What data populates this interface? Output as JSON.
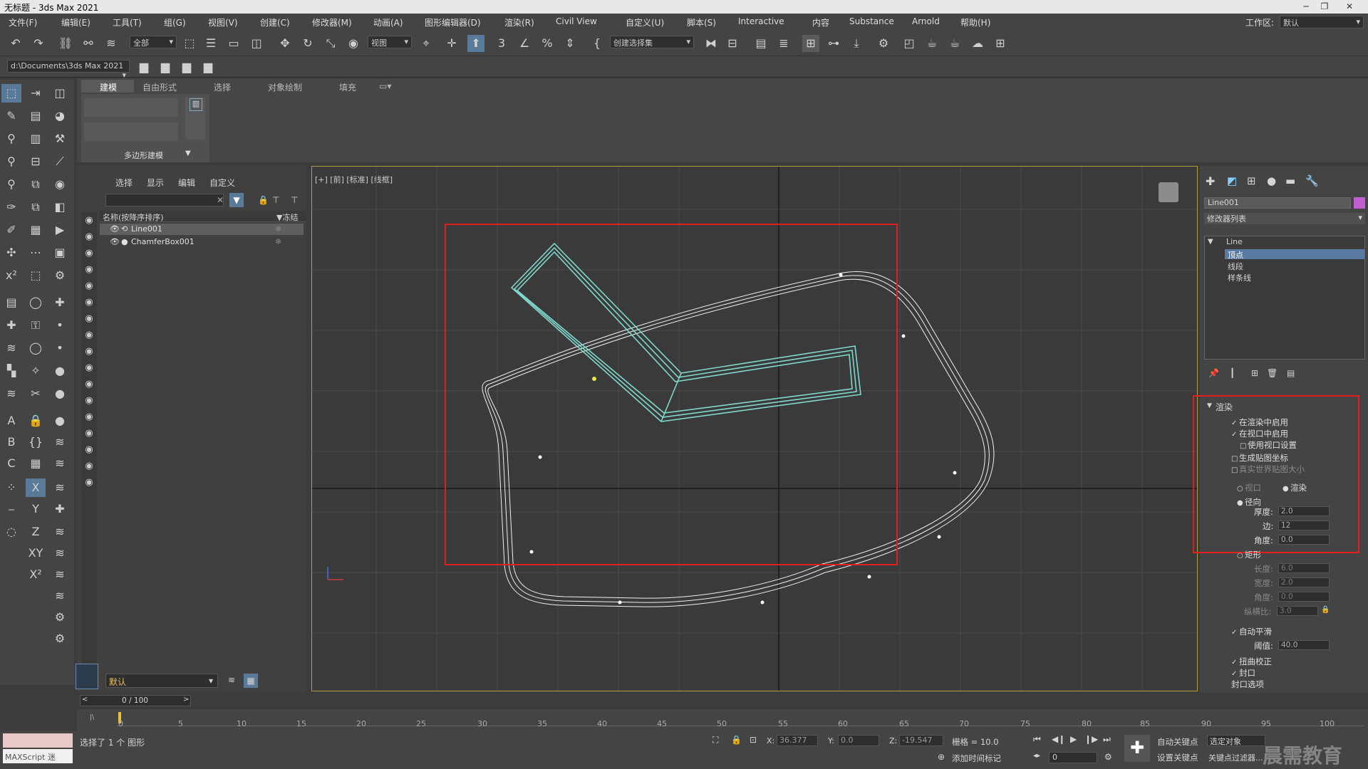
{
  "window": {
    "title": "无标题 - 3ds Max 2021",
    "minimize": "─",
    "restore": "❐",
    "close": "✕"
  },
  "menu": [
    "文件(F)",
    "编辑(E)",
    "工具(T)",
    "组(G)",
    "视图(V)",
    "创建(C)",
    "修改器(M)",
    "动画(A)",
    "图形编辑器(D)",
    "渲染(R)",
    "Civil View",
    "自定义(U)",
    "脚本(S)",
    "Interactive",
    "内容",
    "Substance",
    "Arnold",
    "帮助(H)"
  ],
  "workspace": {
    "label": "工作区:",
    "value": "默认"
  },
  "toolbar": {
    "filter": "全部",
    "coord": "视图",
    "selection_set": "创建选择集",
    "project_path": "d:\\Documents\\3ds Max 2021"
  },
  "ribbon": {
    "tabs": [
      "建模",
      "自由形式",
      "选择",
      "对象绘制",
      "填充"
    ],
    "group_label": "多边形建模"
  },
  "explorer": {
    "tabs": [
      "选择",
      "显示",
      "编辑",
      "自定义"
    ],
    "col_name": "名称(按降序排序)",
    "col_freeze": "▼冻结",
    "rows": [
      "Line001",
      "ChamferBox001"
    ],
    "layer": "默认"
  },
  "viewport": {
    "label": "[+] [前] [标准] [线框]"
  },
  "cmdpanel": {
    "object_name": "Line001",
    "modifier_list": "修改器列表",
    "stack": {
      "root": "Line",
      "items": [
        "顶点",
        "线段",
        "样条线"
      ]
    },
    "rollout_title": "渲染",
    "opts": {
      "enable_render": "在渲染中启用",
      "enable_viewport": "在视口中启用",
      "use_vp_settings": "使用视口设置",
      "gen_map": "生成贴图坐标",
      "real_world": "真实世界贴图大小",
      "viewport": "视口",
      "render": "渲染",
      "radial": "径向",
      "thickness_label": "厚度:",
      "thickness": "2.0",
      "sides_label": "边:",
      "sides": "12",
      "angle_label": "角度:",
      "angle": "0.0",
      "rect": "矩形",
      "length_label": "长度:",
      "length": "6.0",
      "width_label": "宽度:",
      "width": "2.0",
      "rangle_label": "角度:",
      "rangle": "0.0",
      "aspect_label": "纵横比:",
      "aspect": "3.0",
      "auto_smooth": "自动平滑",
      "threshold_label": "阈值:",
      "threshold": "40.0",
      "twist": "扭曲校正",
      "cap": "封口",
      "cap_opts": "封口选项"
    }
  },
  "timeline": {
    "frame": "0 / 100",
    "ticks": [
      "0",
      "5",
      "10",
      "15",
      "20",
      "25",
      "30",
      "35",
      "40",
      "45",
      "50",
      "55",
      "60",
      "65",
      "70",
      "75",
      "80",
      "85",
      "90",
      "95",
      "100"
    ]
  },
  "status": {
    "selection": "选择了 1 个 图形",
    "x_label": "X:",
    "x": "36.377",
    "y_label": "Y:",
    "y": "0.0",
    "z_label": "Z:",
    "z": "-19.547",
    "grid": "栅格 = 10.0",
    "add_time_tag": "添加时间标记",
    "auto_key": "自动关键点",
    "set_key": "设置关键点",
    "selected_obj": "选定对象",
    "key_filter": "关键点过滤器...",
    "frame_field": "0",
    "maxscript": "MAXScript 迷",
    "watermark": "晨需教育"
  }
}
